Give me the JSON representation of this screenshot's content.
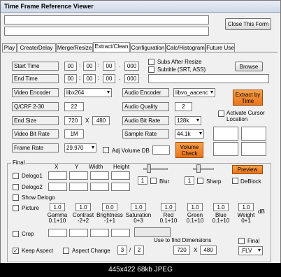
{
  "window": {
    "title": "Time Frame Reference Viewer",
    "close_form": "Close This Form"
  },
  "tabs": [
    "Play",
    "Create/Delay",
    "Merge/Resize",
    "Extract/Clean",
    "Configuration",
    "Calc/Histogram",
    "Future Use"
  ],
  "time": {
    "start_label": "Start Time",
    "end_label": "End Time",
    "start": [
      "00",
      "00",
      "00",
      "000"
    ],
    "end": [
      "00",
      "00",
      "00",
      "000"
    ],
    "sep": ":",
    "dot": "."
  },
  "subs": {
    "subs_after_resize": "Subs After Resize",
    "subtitle": "Subtitle (SRT, ASS)",
    "browse": "Browse"
  },
  "video": {
    "encoder_label": "Video Encoder",
    "encoder": "libx264",
    "crf_label": "Q/CRF  2-30",
    "crf": "22",
    "size_label": "End Size",
    "width": "720",
    "x": "X",
    "height": "480",
    "bitrate_label": "Video Bit Rate",
    "bitrate": "1M",
    "framerate_label": "Frame Rate",
    "framerate": "29.970"
  },
  "audio": {
    "encoder_label": "Audio Encoder",
    "encoder": "libvo_aacenc",
    "quality_label": "Audio Quality",
    "quality": "2",
    "bitrate_label": "Audio Bit Rate",
    "bitrate": "128k",
    "sample_label": "Sample Rate",
    "sample": "44.1k",
    "adj_volume": "Adj Volume DB"
  },
  "buttons": {
    "extract_by_time": "Extract by Time",
    "volume_check": "Volume Check",
    "preview": "Preview"
  },
  "cursor": {
    "label": "Activate Cursor Location"
  },
  "final": {
    "legend": "Final",
    "col_x": "X",
    "col_y": "Y",
    "col_width": "Width",
    "col_height": "Height",
    "delogo1": "Delogo1",
    "delogo2": "Delogo2",
    "show_delogo": "Show Delogo",
    "picture": "Picture",
    "crop": "Crop",
    "blur_val": "1",
    "blur": "Blur",
    "sharp_val": "1",
    "sharp": "Sharp",
    "deblock": "DeBlock",
    "db": "dB"
  },
  "picture": {
    "values": [
      "1.0",
      "1.0",
      "0.0",
      "1.0",
      "1.0",
      "1.0",
      "1.0",
      "1.0"
    ],
    "labels": [
      [
        "Gamma",
        "0.1+10"
      ],
      [
        "Contrast",
        "-2+2"
      ],
      [
        "Brightness",
        "-1+1"
      ],
      [
        "Saturation",
        "0+3"
      ],
      [
        "Red",
        "0.1+10"
      ],
      [
        "Green",
        "0.1+10"
      ],
      [
        "Blue",
        "0.1+10"
      ],
      [
        "Weight",
        "0+1"
      ]
    ]
  },
  "bottom": {
    "keep_aspect": "Keep Aspect",
    "aspect_change": "Aspect Change",
    "aspect_w": "3",
    "slash": "/",
    "aspect_h": "2",
    "use_dims": "Use to find Dimensions",
    "dim_w": "720",
    "x": "X",
    "dim_h": "480",
    "final": "Final",
    "format": ".FLV"
  },
  "status": "445x422 68kb JPEG"
}
